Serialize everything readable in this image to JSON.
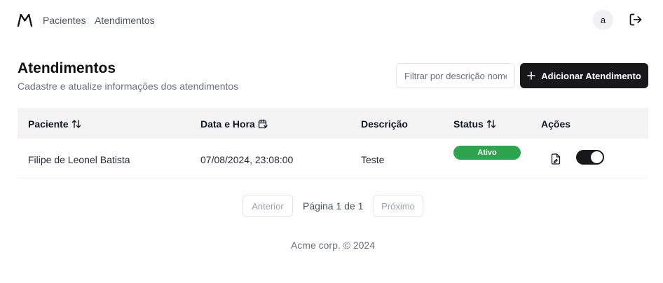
{
  "nav": {
    "logo": "mountain-logo-icon",
    "links": [
      "Pacientes",
      "Atendimentos"
    ],
    "avatar_initial": "a",
    "logout_icon": "logout-icon"
  },
  "header": {
    "title": "Atendimentos",
    "subtitle": "Cadastre e atualize informações dos atendimentos"
  },
  "filter": {
    "placeholder": "Filtrar por descrição nome",
    "value": ""
  },
  "add_button": {
    "label": "Adicionar Atendimento",
    "icon": "plus-icon"
  },
  "table": {
    "columns": [
      {
        "label": "Paciente",
        "icon": "sort-arrows-icon"
      },
      {
        "label": "Data e Hora",
        "icon": "calendar-icon"
      },
      {
        "label": "Descrição"
      },
      {
        "label": "Status",
        "icon": "sort-arrows-icon"
      },
      {
        "label": "Ações"
      }
    ],
    "rows": [
      {
        "paciente": "Filipe de Leonel Batista",
        "data_hora": "07/08/2024, 23:08:00",
        "descricao": "Teste",
        "status": "Ativo",
        "status_color": "#2ea44f",
        "active": true
      }
    ]
  },
  "pagination": {
    "prev_label": "Anterior",
    "info": "Página 1 de 1",
    "next_label": "Próximo"
  },
  "footer": {
    "text": "Acme corp. © 2024"
  },
  "colors": {
    "primary": "#18181b",
    "success": "#2ea44f",
    "header_bg": "#f4f4f5"
  }
}
